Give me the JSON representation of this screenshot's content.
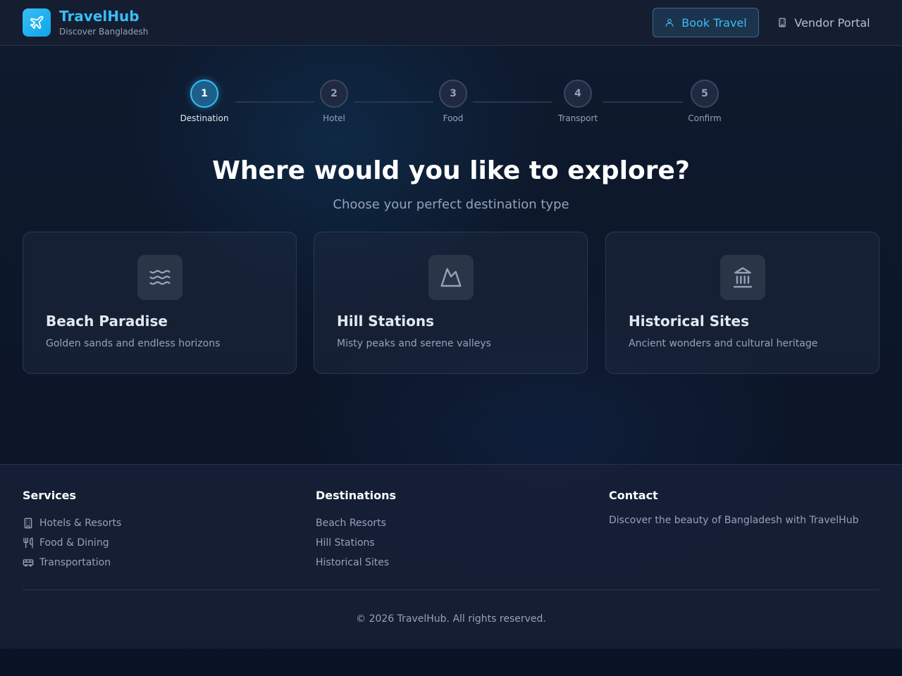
{
  "header": {
    "brand_title": "TravelHub",
    "brand_subtitle": "Discover Bangladesh",
    "logo_icon": "airplane-icon",
    "book_travel_label": "Book Travel",
    "vendor_portal_label": "Vendor Portal"
  },
  "stepper": {
    "active_step": 1,
    "steps": [
      {
        "number": "1",
        "label": "Destination"
      },
      {
        "number": "2",
        "label": "Hotel"
      },
      {
        "number": "3",
        "label": "Food"
      },
      {
        "number": "4",
        "label": "Transport"
      },
      {
        "number": "5",
        "label": "Confirm"
      }
    ]
  },
  "hero": {
    "title": "Where would you like to explore?",
    "subtitle": "Choose your perfect destination type"
  },
  "destination_cards": [
    {
      "icon": "waves-icon",
      "title": "Beach Paradise",
      "description": "Golden sands and endless horizons"
    },
    {
      "icon": "mountain-icon",
      "title": "Hill Stations",
      "description": "Misty peaks and serene valleys"
    },
    {
      "icon": "landmark-icon",
      "title": "Historical Sites",
      "description": "Ancient wonders and cultural heritage"
    }
  ],
  "footer": {
    "services": {
      "heading": "Services",
      "items": [
        {
          "icon": "building-icon",
          "label": "Hotels & Resorts"
        },
        {
          "icon": "utensils-icon",
          "label": "Food & Dining"
        },
        {
          "icon": "bus-icon",
          "label": "Transportation"
        }
      ]
    },
    "destinations": {
      "heading": "Destinations",
      "items": [
        "Beach Resorts",
        "Hill Stations",
        "Historical Sites"
      ]
    },
    "contact": {
      "heading": "Contact",
      "text": "Discover the beauty of Bangladesh with TravelHub"
    },
    "copyright": "© 2026 TravelHub. All rights reserved."
  },
  "colors": {
    "accent": "#38bdf8",
    "background": "#0b1426",
    "card_bg": "#1e283e",
    "muted_text": "#94a3b8"
  }
}
